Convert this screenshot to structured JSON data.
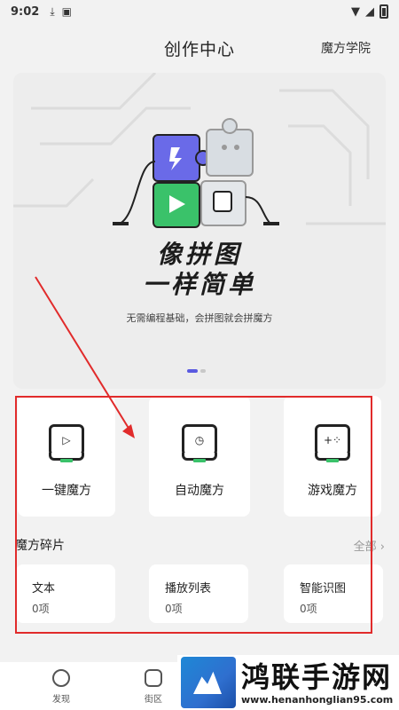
{
  "status_bar": {
    "time": "9:02"
  },
  "header": {
    "title": "创作中心",
    "academy_link": "魔方学院"
  },
  "banner": {
    "slogan_line1": "像拼图",
    "slogan_line2": "一样简单",
    "subtitle": "无需编程基础，会拼图就会拼魔方",
    "pagination": {
      "current": 1,
      "total": 2
    }
  },
  "modes": [
    {
      "label": "一键魔方",
      "icon": "play-icon"
    },
    {
      "label": "自动魔方",
      "icon": "clock-icon"
    },
    {
      "label": "游戏魔方",
      "icon": "gamepad-icon"
    }
  ],
  "fragments": {
    "title": "魔方碎片",
    "all_link": "全部 ›",
    "items": [
      {
        "name": "文本",
        "count": "0项"
      },
      {
        "name": "播放列表",
        "count": "0项"
      },
      {
        "name": "智能识图",
        "count": "0项"
      }
    ]
  },
  "tabbar": {
    "tabs": [
      {
        "label": "发现",
        "icon": "alien-icon"
      },
      {
        "label": "街区",
        "icon": "chat-icon"
      }
    ]
  },
  "watermark": {
    "title": "鸿联手游网",
    "url": "www.henanhonglian95.com"
  },
  "colors": {
    "accent": "#5a5ae0",
    "annotation": "#e12b2b",
    "green": "#3ac26a"
  }
}
